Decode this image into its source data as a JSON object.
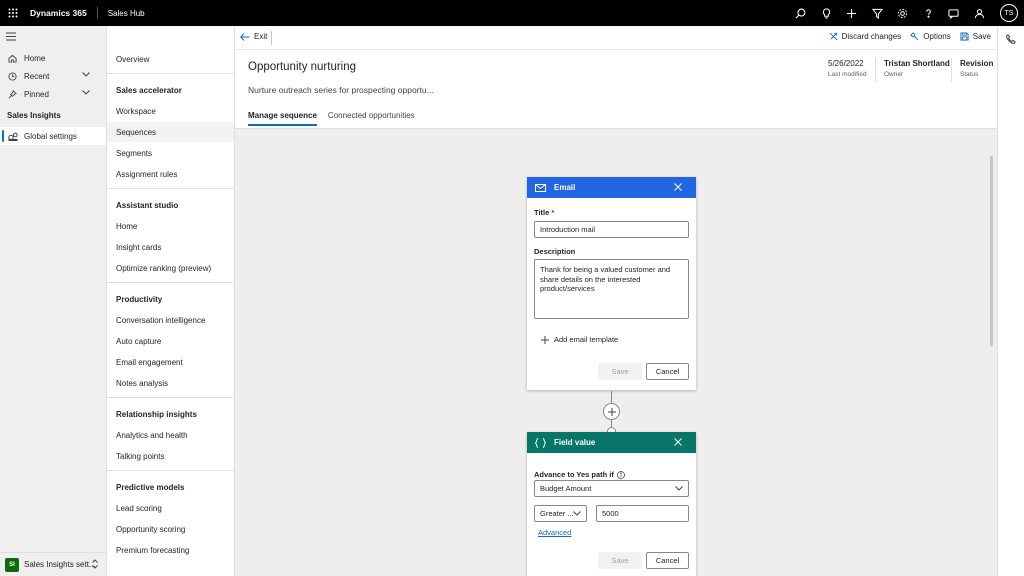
{
  "topbar": {
    "app_name": "Dynamics 365",
    "app_sub": "Sales Hub",
    "avatar_initials": "TS",
    "icons": [
      "search-icon",
      "lightbulb-icon",
      "plus-icon",
      "filter-icon",
      "gear-icon",
      "help-icon",
      "chat-icon",
      "person-feedback-icon"
    ]
  },
  "leftnav": {
    "home": "Home",
    "recent": "Recent",
    "pinned": "Pinned",
    "section": "Sales Insights",
    "global_settings": "Global settings",
    "area_badge": "SI",
    "area_label": "Sales Insights sett..."
  },
  "subnav": {
    "overview": "Overview",
    "groups": [
      {
        "title": "Sales accelerator",
        "items": [
          "Workspace",
          "Sequences",
          "Segments",
          "Assignment rules"
        ]
      },
      {
        "title": "Assistant studio",
        "items": [
          "Home",
          "Insight cards",
          "Optimize ranking (preview)"
        ]
      },
      {
        "title": "Productivity",
        "items": [
          "Conversation intelligence",
          "Auto capture",
          "Email engagement",
          "Notes analysis"
        ]
      },
      {
        "title": "Relationship insights",
        "items": [
          "Analytics and health",
          "Talking points"
        ]
      },
      {
        "title": "Predictive models",
        "items": [
          "Lead scoring",
          "Opportunity scoring",
          "Premium forecasting"
        ]
      }
    ]
  },
  "cmdbar": {
    "exit": "Exit",
    "discard": "Discard changes",
    "options": "Options",
    "save": "Save"
  },
  "header": {
    "title": "Opportunity nurturing",
    "description": "Nurture outreach series for prospecting opportu...",
    "meta": [
      {
        "value": "5/26/2022",
        "label": "Last modified"
      },
      {
        "value": "Tristan Shortland",
        "label": "Owner"
      },
      {
        "value": "Revision",
        "label": "Status"
      }
    ]
  },
  "tabs": [
    "Manage sequence",
    "Connected opportunities"
  ],
  "email_card": {
    "title": "Email",
    "color": "#2266e3",
    "title_label": "Title",
    "required_mark": "*",
    "title_value": "Introduction mail",
    "description_label": "Description",
    "description_value": "Thank for being a valued customer and share details on the interested product/services",
    "add_template": "Add email template",
    "save": "Save",
    "cancel": "Cancel"
  },
  "field_card": {
    "title": "Field value",
    "color": "#077568",
    "condition_label": "Advance to Yes path if",
    "field_value": "Budget Amount",
    "operator_value": "Greater ...",
    "compare_value": "5000",
    "advanced_link": "Advanced",
    "save": "Save",
    "cancel": "Cancel"
  }
}
